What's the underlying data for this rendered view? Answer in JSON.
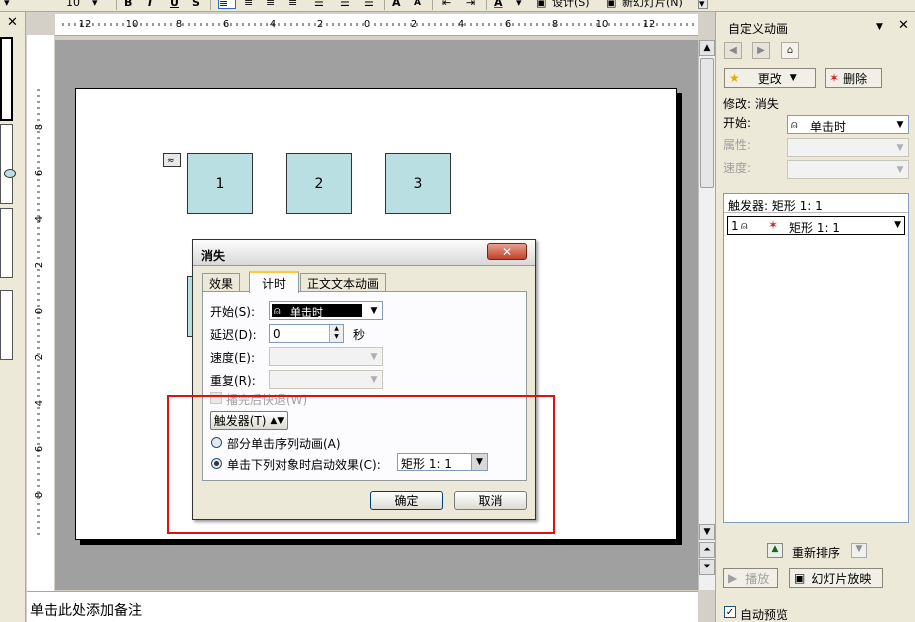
{
  "toolbar": {
    "font_size": "10",
    "bold": "B",
    "italic": "I",
    "underline": "U",
    "shadow": "S",
    "grow_font": "A",
    "shrink_font": "A",
    "design_label": "设计(S)",
    "new_slide_label": "新幻灯片(N)"
  },
  "hruler_labels": [
    "12",
    "10",
    "8",
    "6",
    "4",
    "2",
    "0",
    "2",
    "4",
    "6",
    "8",
    "10",
    "12"
  ],
  "vruler_labels": [
    "8",
    "6",
    "4",
    "2",
    "0",
    "2",
    "4",
    "6",
    "8"
  ],
  "slide": {
    "shapes": [
      {
        "label": "1"
      },
      {
        "label": "2"
      },
      {
        "label": "3"
      }
    ]
  },
  "notes": {
    "placeholder": "单击此处添加备注"
  },
  "dialog": {
    "title": "消失",
    "close_label": "✕",
    "tabs": [
      {
        "label": "效果",
        "active": false
      },
      {
        "label": "计时",
        "active": true
      },
      {
        "label": "正文文本动画",
        "active": false
      }
    ],
    "start_label": "开始(S):",
    "start_value": "单击时",
    "delay_label": "延迟(D):",
    "delay_value": "0",
    "delay_unit": "秒",
    "speed_label": "速度(E):",
    "repeat_label": "重复(R):",
    "rewind_label": "播完后快退(W)",
    "trigger_button": "触发器(T)",
    "option_sequence": "部分单击序列动画(A)",
    "option_click_object": "单击下列对象时启动效果(C):",
    "object_value": "矩形 1: 1",
    "ok_label": "确定",
    "cancel_label": "取消"
  },
  "task_pane": {
    "title": "自定义动画",
    "change_label": "更改",
    "remove_label": "删除",
    "modify_text": "修改: 消失",
    "start_label": "开始:",
    "start_value": "单击时",
    "property_label": "属性:",
    "speed_label": "速度:",
    "trigger_header": "触发器: 矩形 1: 1",
    "item_index": "1",
    "item_label": "矩形 1: 1",
    "reorder_label": "重新排序",
    "play_label": "播放",
    "slideshow_label": "幻灯片放映",
    "autopreview_label": "自动预览"
  },
  "colors": {
    "shape_fill": "#b9dfe2",
    "highlight": "#e01010",
    "canvas": "#a0a0a0"
  }
}
